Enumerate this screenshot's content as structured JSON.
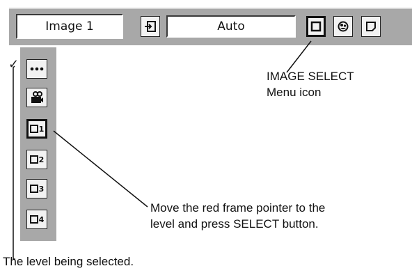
{
  "toolbar": {
    "input_source": "Image 1",
    "mode": "Auto",
    "icons": [
      "input-icon",
      "image-select-icon",
      "color-icon",
      "screen-icon"
    ]
  },
  "menu": {
    "items": [
      {
        "icon": "dots-icon",
        "label": ""
      },
      {
        "icon": "camera-icon",
        "label": ""
      },
      {
        "icon": "frame-icon",
        "label": "1"
      },
      {
        "icon": "frame-icon",
        "label": "2"
      },
      {
        "icon": "frame-icon",
        "label": "3"
      },
      {
        "icon": "frame-icon",
        "label": "4"
      }
    ],
    "selected_mark": "✓"
  },
  "callouts": {
    "image_select": [
      "IMAGE SELECT",
      "Menu icon"
    ],
    "pointer": [
      "Move the red frame pointer to the",
      "level and press SELECT button."
    ],
    "selected": "The level being selected."
  }
}
